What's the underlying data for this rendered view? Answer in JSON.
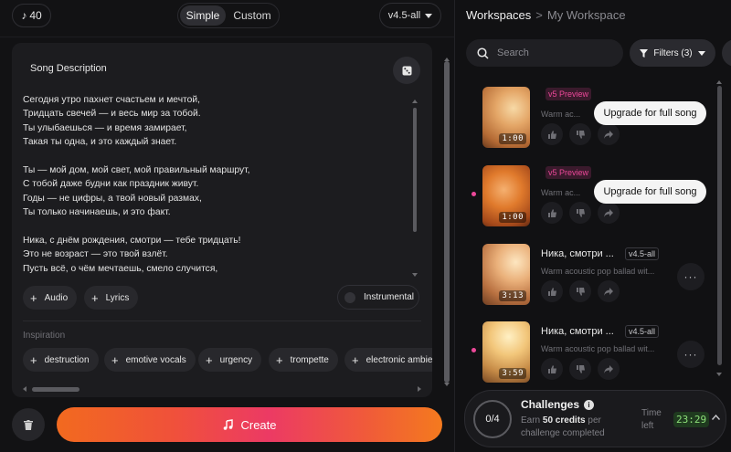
{
  "header": {
    "credits": "40",
    "modes": [
      "Simple",
      "Custom"
    ],
    "active_mode": "Simple",
    "version": "v4.5-all"
  },
  "song_description": {
    "title": "Song Description",
    "lyrics": [
      "Сегодня утро пахнет счастьем и мечтой,",
      "Тридцать свечей — и весь мир за тобой.",
      "Ты улыбаешься — и время замирает,",
      "Такая ты одна, и это каждый знает.",
      "",
      "Ты — мой дом, мой свет, мой правильный маршрут,",
      "С тобой даже будни как праздник живут.",
      "Годы — не цифры, а твой новый размах,",
      "Ты только начинаешь, и это факт.",
      "",
      "Ника, с днём рождения, смотри — тебе тридцать!",
      "Это не возраст — это твой взлёт.",
      "Пусть всё, о чём мечтаешь, смело случится,"
    ],
    "add_audio": "Audio",
    "add_lyrics": "Lyrics",
    "instrumental": "Instrumental"
  },
  "inspiration": {
    "label": "Inspiration",
    "tags": [
      "destruction",
      "emotive vocals",
      "urgency",
      "trompette",
      "electronic ambie"
    ]
  },
  "create_label": "Create",
  "workspace": {
    "root": "Workspaces",
    "separator": ">",
    "current": "My Workspace",
    "search_placeholder": "Search",
    "filters_label": "Filters (3)"
  },
  "songs": [
    {
      "title": "",
      "badge": "v5 Preview",
      "subtitle": "Warm ac...",
      "duration": "1:00",
      "upgrade": "Upgrade for full song",
      "new": false
    },
    {
      "title": "",
      "badge": "v5 Preview",
      "subtitle": "Warm ac...",
      "duration": "1:00",
      "upgrade": "Upgrade for full song",
      "new": true
    },
    {
      "title": "Ника, смотри ...",
      "badge": "v4.5-all",
      "subtitle": "Warm acoustic pop ballad wit...",
      "duration": "3:13",
      "upgrade": "",
      "new": false
    },
    {
      "title": "Ника, смотри ...",
      "badge": "v4.5-all",
      "subtitle": "Warm acoustic pop ballad wit...",
      "duration": "3:59",
      "upgrade": "",
      "new": true
    }
  ],
  "challenges": {
    "progress": "0/4",
    "title": "Challenges",
    "desc_prefix": "Earn",
    "desc_credits": "50 credits",
    "desc_suffix": "per challenge completed",
    "time_label": "Time left",
    "timer": "23:29"
  },
  "colors": {
    "accent_pink": "#ec4899",
    "create_gradient_start": "#f26a1f",
    "create_gradient_mid": "#ec3a64",
    "timer_green": "#8ee07a"
  }
}
